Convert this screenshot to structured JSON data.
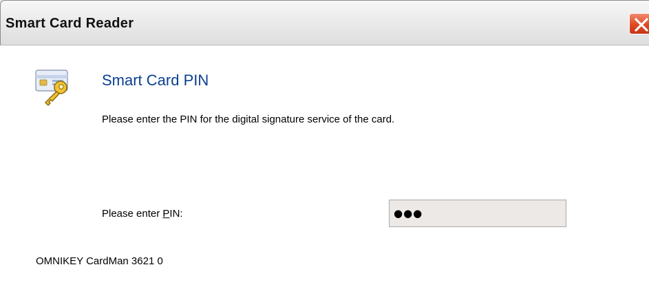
{
  "window": {
    "title": "Smart Card Reader",
    "close_icon": "close-icon"
  },
  "header": {
    "icon": "smart-card-key-icon",
    "title": "Smart Card PIN",
    "description": "Please enter the PIN for the digital signature service of the card."
  },
  "form": {
    "pin_label_prefix": "Please enter ",
    "pin_label_accel": "P",
    "pin_label_suffix": "IN:",
    "pin_value": "●●●"
  },
  "footer": {
    "reader_name": "OMNIKEY CardMan 3621 0"
  },
  "colors": {
    "title_accent": "#0b3f8f",
    "close_button": "#df4a22",
    "input_background": "#ece9e6"
  }
}
